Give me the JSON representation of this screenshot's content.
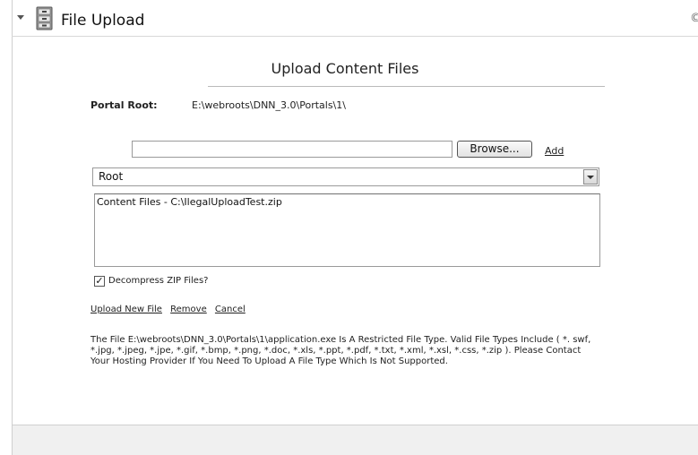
{
  "module": {
    "title": "File Upload",
    "icon": "file-cabinet-icon",
    "edge_icon": "©"
  },
  "page": {
    "heading": "Upload Content Files"
  },
  "portal": {
    "label": "Portal Root:",
    "value": "E:\\webroots\\DNN_3.0\\Portals\\1\\"
  },
  "upload": {
    "file_value": "",
    "browse_label": "Browse...",
    "add_label": "Add"
  },
  "folder": {
    "selected": "Root"
  },
  "file_list": {
    "items": [
      "Content Files - C:\\IlegalUploadTest.zip"
    ]
  },
  "options": {
    "decompress_label": "Decompress ZIP Files?",
    "decompress_checked": true,
    "check_mark": "✓"
  },
  "actions": {
    "upload_new": "Upload New File",
    "remove": "Remove",
    "cancel": "Cancel"
  },
  "message": {
    "text": "The File E:\\webroots\\DNN_3.0\\Portals\\1\\application.exe Is A Restricted File Type. Valid File Types Include ( *. swf, *.jpg, *.jpeg, *.jpe, *.gif, *.bmp, *.png, *.doc, *.xls, *.ppt, *.pdf, *.txt, *.xml, *.xsl, *.css, *.zip ). Please Contact Your Hosting Provider If You Need To Upload A File Type Which Is Not Supported."
  }
}
